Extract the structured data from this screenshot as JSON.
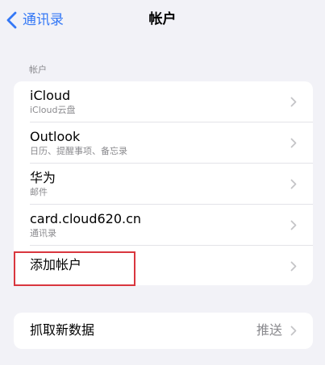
{
  "nav": {
    "back_label": "通讯录",
    "title": "帐户"
  },
  "accounts_section": {
    "header": "帐户",
    "rows": [
      {
        "title": "iCloud",
        "subtitle": "iCloud云盘"
      },
      {
        "title": "Outlook",
        "subtitle": "日历、提醒事项、备忘录"
      },
      {
        "title": "华为",
        "subtitle": "邮件"
      },
      {
        "title": "card.cloud620.cn",
        "subtitle": "通讯录"
      },
      {
        "title": "添加帐户"
      }
    ]
  },
  "fetch_section": {
    "title": "抓取新数据",
    "value": "推送"
  },
  "icons": {
    "back": "chevron-left-icon",
    "disclosure": "chevron-right-icon"
  },
  "colors": {
    "background": "#f2f2f7",
    "accent": "#3478f6",
    "secondary_text": "#8a8a8e",
    "highlight": "#d9363e"
  }
}
